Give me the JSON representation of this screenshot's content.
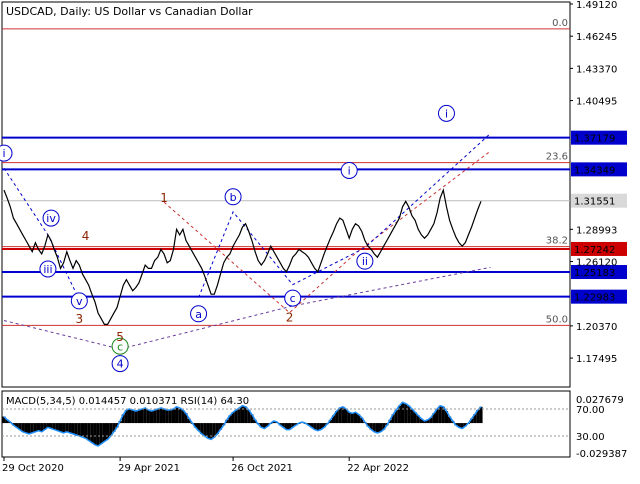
{
  "chart_data": {
    "type": "line",
    "title": "USDCAD, Daily:  US Dollar vs Canadian Dollar",
    "price_axis": {
      "ylim": [
        1.15,
        1.4912
      ],
      "ticks": [
        "1.49120",
        "1.46245",
        "1.43370",
        "1.40495",
        "1.28993",
        "1.26120",
        "1.20370",
        "1.17495"
      ]
    },
    "date_labels": [
      "29 Oct 2020",
      "29 Apr 2021",
      "26 Oct 2021",
      "22 Apr 2022"
    ],
    "series": [
      {
        "values": [
          1.325,
          1.318,
          1.31,
          1.3,
          1.295,
          1.29,
          1.285,
          1.28,
          1.275,
          1.27,
          1.278,
          1.272,
          1.268,
          1.275,
          1.285,
          1.28,
          1.272,
          1.265,
          1.255,
          1.26,
          1.27,
          1.262,
          1.255,
          1.262,
          1.258,
          1.25,
          1.245,
          1.24,
          1.232,
          1.225,
          1.215,
          1.21,
          1.205,
          1.205,
          1.21,
          1.215,
          1.22,
          1.23,
          1.24,
          1.245,
          1.24,
          1.235,
          1.238,
          1.242,
          1.25,
          1.258,
          1.255,
          1.255,
          1.262,
          1.265,
          1.272,
          1.268,
          1.26,
          1.262,
          1.272,
          1.29,
          1.285,
          1.29,
          1.28,
          1.275,
          1.27,
          1.265,
          1.26,
          1.255,
          1.248,
          1.24,
          1.232,
          1.232,
          1.24,
          1.25,
          1.26,
          1.265,
          1.268,
          1.275,
          1.28,
          1.285,
          1.292,
          1.295,
          1.288,
          1.28,
          1.27,
          1.262,
          1.258,
          1.262,
          1.268,
          1.275,
          1.27,
          1.265,
          1.26,
          1.255,
          1.252,
          1.258,
          1.265,
          1.268,
          1.272,
          1.27,
          1.268,
          1.265,
          1.26,
          1.255,
          1.252,
          1.26,
          1.268,
          1.275,
          1.282,
          1.288,
          1.295,
          1.3,
          1.298,
          1.29,
          1.282,
          1.29,
          1.295,
          1.293,
          1.288,
          1.28,
          1.275,
          1.272,
          1.268,
          1.265,
          1.27,
          1.275,
          1.28,
          1.285,
          1.29,
          1.295,
          1.3,
          1.31,
          1.315,
          1.31,
          1.302,
          1.298,
          1.29,
          1.285,
          1.282,
          1.285,
          1.29,
          1.295,
          1.305,
          1.318,
          1.325,
          1.31,
          1.298,
          1.29,
          1.283,
          1.278,
          1.275,
          1.278,
          1.285,
          1.292,
          1.3,
          1.308,
          1.315
        ],
        "color": "#000000"
      }
    ],
    "levels": [
      {
        "label": "1.37179",
        "value": 1.3718
      },
      {
        "label": "1.34349",
        "value": 1.3435
      },
      {
        "label": "1.27242",
        "value": 1.2724
      },
      {
        "label": "1.25183",
        "value": 1.2518
      },
      {
        "label": "1.22983",
        "value": 1.2298
      }
    ],
    "current_price": {
      "label": "1.31551",
      "value": 1.3155
    },
    "fib_levels": [
      {
        "label": "0.0",
        "value": 1.469
      },
      {
        "label": "23.6",
        "value": 1.3495
      },
      {
        "label": "38.2",
        "value": 1.2745
      },
      {
        "label": "50.0",
        "value": 1.2042
      }
    ],
    "wave_labels": {
      "blue_circled": [
        {
          "text": "i",
          "x": 0,
          "y": 1.358
        },
        {
          "text": "iv",
          "x": 15,
          "y": 1.3
        },
        {
          "text": "iii",
          "x": 14,
          "y": 1.2545
        },
        {
          "text": "v",
          "x": 24,
          "y": 1.226
        },
        {
          "text": "b",
          "x": 73,
          "y": 1.319
        },
        {
          "text": "a",
          "x": 62,
          "y": 1.2145
        },
        {
          "text": "c",
          "x": 92,
          "y": 1.2285
        },
        {
          "text": "i",
          "x": 110,
          "y": 1.3425
        },
        {
          "text": "ii",
          "x": 115,
          "y": 1.2615
        },
        {
          "text": "4",
          "x": 37,
          "y": 1.17
        },
        {
          "text": "i",
          "x": 141,
          "y": 1.3935
        }
      ],
      "green_circled": [
        {
          "text": "c",
          "x": 37,
          "y": 1.1855
        }
      ],
      "brown": [
        {
          "text": "1",
          "x": 51,
          "y": 1.3142
        },
        {
          "text": "4",
          "x": 26,
          "y": 1.2806
        },
        {
          "text": "3",
          "x": 24,
          "y": 1.2062
        },
        {
          "text": "5",
          "x": 37,
          "y": 1.19
        },
        {
          "text": "2",
          "x": 91,
          "y": 1.2077
        }
      ]
    },
    "indicator": {
      "text": "MACD(5,34,5) 0.014457 0.010371 RSI(14) 64.30",
      "ticks": [
        "0.027679",
        "70.00",
        "30.00",
        "-0.029387"
      ],
      "macd": [
        0.006,
        0.003,
        0.001,
        -0.002,
        -0.004,
        -0.006,
        -0.008,
        -0.009,
        -0.01,
        -0.009,
        -0.008,
        -0.007,
        -0.008,
        -0.006,
        -0.004,
        -0.005,
        -0.006,
        -0.007,
        -0.008,
        -0.009,
        -0.008,
        -0.009,
        -0.01,
        -0.011,
        -0.012,
        -0.013,
        -0.014,
        -0.016,
        -0.018,
        -0.02,
        -0.021,
        -0.019,
        -0.017,
        -0.015,
        -0.012,
        -0.008,
        -0.004,
        0.002,
        0.008,
        0.012,
        0.013,
        0.012,
        0.011,
        0.012,
        0.013,
        0.014,
        0.012,
        0.011,
        0.012,
        0.013,
        0.014,
        0.013,
        0.012,
        0.012,
        0.013,
        0.015,
        0.014,
        0.012,
        0.009,
        0.004,
        0.0,
        -0.004,
        -0.007,
        -0.01,
        -0.012,
        -0.014,
        -0.015,
        -0.013,
        -0.01,
        -0.006,
        -0.002,
        0.003,
        0.007,
        0.01,
        0.012,
        0.014,
        0.016,
        0.015,
        0.012,
        0.008,
        0.003,
        -0.001,
        -0.004,
        -0.005,
        -0.003,
        0.0,
        0.002,
        0.001,
        -0.002,
        -0.004,
        -0.006,
        -0.006,
        -0.004,
        -0.002,
        0.0,
        0.001,
        0.0,
        -0.002,
        -0.004,
        -0.006,
        -0.007,
        -0.006,
        -0.004,
        -0.001,
        0.003,
        0.007,
        0.011,
        0.014,
        0.015,
        0.013,
        0.01,
        0.009,
        0.01,
        0.008,
        0.005,
        0.001,
        -0.003,
        -0.006,
        -0.008,
        -0.009,
        -0.008,
        -0.006,
        -0.002,
        0.003,
        0.008,
        0.012,
        0.016,
        0.019,
        0.018,
        0.016,
        0.013,
        0.01,
        0.007,
        0.004,
        0.002,
        0.003,
        0.005,
        0.009,
        0.013,
        0.016,
        0.015,
        0.011,
        0.006,
        0.002,
        -0.002,
        -0.004,
        -0.005,
        -0.003,
        0.0,
        0.004,
        0.008,
        0.012,
        0.015
      ],
      "rsi": [
        0.006,
        0.003,
        0.001,
        -0.002,
        -0.004,
        -0.006,
        -0.008,
        -0.009,
        -0.01,
        -0.009,
        -0.008,
        -0.007,
        -0.008,
        -0.006,
        -0.004,
        -0.005,
        -0.006,
        -0.007,
        -0.008,
        -0.009,
        -0.008,
        -0.009,
        -0.01,
        -0.011,
        -0.012,
        -0.013,
        -0.014,
        -0.016,
        -0.018,
        -0.02,
        -0.021,
        -0.019,
        -0.017,
        -0.015,
        -0.012,
        -0.008,
        -0.004,
        0.002,
        0.008,
        0.012,
        0.013,
        0.012,
        0.011,
        0.012,
        0.013,
        0.014,
        0.012,
        0.011,
        0.012,
        0.013,
        0.014,
        0.013,
        0.012,
        0.012,
        0.013,
        0.015,
        0.014,
        0.012,
        0.009,
        0.004,
        0.0,
        -0.004,
        -0.007,
        -0.01,
        -0.012,
        -0.014,
        -0.015,
        -0.013,
        -0.01,
        -0.006,
        -0.002,
        0.003,
        0.007,
        0.01,
        0.012,
        0.014,
        0.016,
        0.015,
        0.012,
        0.008,
        0.003,
        -0.001,
        -0.004,
        -0.005,
        -0.003,
        0.0,
        0.002,
        0.001,
        -0.002,
        -0.004,
        -0.006,
        -0.006,
        -0.004,
        -0.002,
        0.0,
        0.001,
        0.0,
        -0.002,
        -0.004,
        -0.006,
        -0.007,
        -0.006,
        -0.004,
        -0.001,
        0.003,
        0.007,
        0.011,
        0.014,
        0.015,
        0.013,
        0.01,
        0.009,
        0.01,
        0.008,
        0.005,
        0.001,
        -0.003,
        -0.006,
        -0.008,
        -0.009,
        -0.008,
        -0.006,
        -0.002,
        0.003,
        0.008,
        0.012,
        0.016,
        0.019,
        0.018,
        0.016,
        0.013,
        0.01,
        0.007,
        0.004,
        0.002,
        0.003,
        0.005,
        0.009,
        0.013,
        0.016,
        0.015,
        0.011,
        0.006,
        0.002,
        -0.002,
        -0.004,
        -0.005,
        -0.003,
        0.0,
        0.004,
        0.008,
        0.012,
        0.015
      ],
      "ylim": [
        -0.029387,
        0.027679
      ]
    },
    "colors": {
      "level_blue": "#0000cc",
      "level_red": "#cc0000",
      "wave_brown": "#8b2500",
      "wave_green": "#1b8a1b",
      "fib_dotted": "#cc3333",
      "macd_fill": "#000000",
      "rsi_line": "#1e90ff",
      "current_price_fill": "#d9d9d9"
    }
  }
}
